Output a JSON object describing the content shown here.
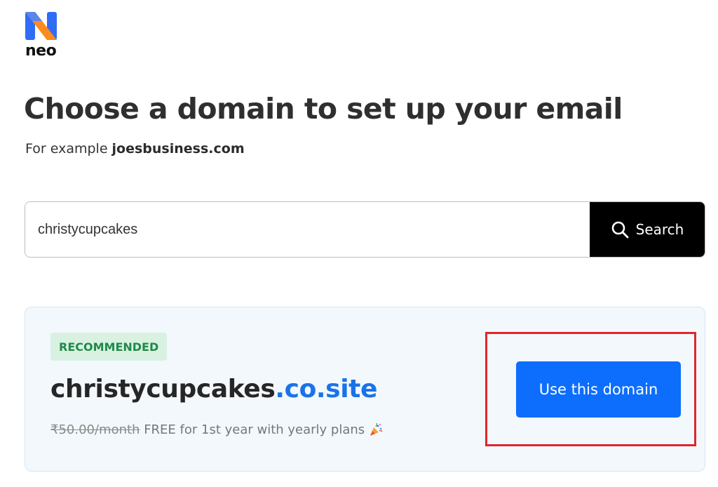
{
  "brand": {
    "name": "neo",
    "icon": "neo-logo-icon",
    "colors": {
      "logo_blue": "#2f6df6",
      "logo_orange": "#ff8a1f"
    }
  },
  "header": {
    "title": "Choose a domain to set up your email",
    "subtitle_prefix": "For example ",
    "subtitle_example": "joesbusiness.com"
  },
  "search": {
    "value": "christycupcakes",
    "button_label": "Search",
    "icon": "search-icon"
  },
  "result": {
    "badge": "RECOMMENDED",
    "domain_base": "christycupcakes",
    "domain_tld": ".co.site",
    "old_price": "₹50.00/month",
    "offer": " FREE for 1st year with yearly plans",
    "icon": "party-popper-icon",
    "button_label": "Use this domain"
  },
  "colors": {
    "accent": "#0d6efd",
    "tld": "#1a73e8",
    "badge_bg": "#d9f1e1",
    "badge_text": "#1f8a4a",
    "highlight": "#e0262b"
  }
}
